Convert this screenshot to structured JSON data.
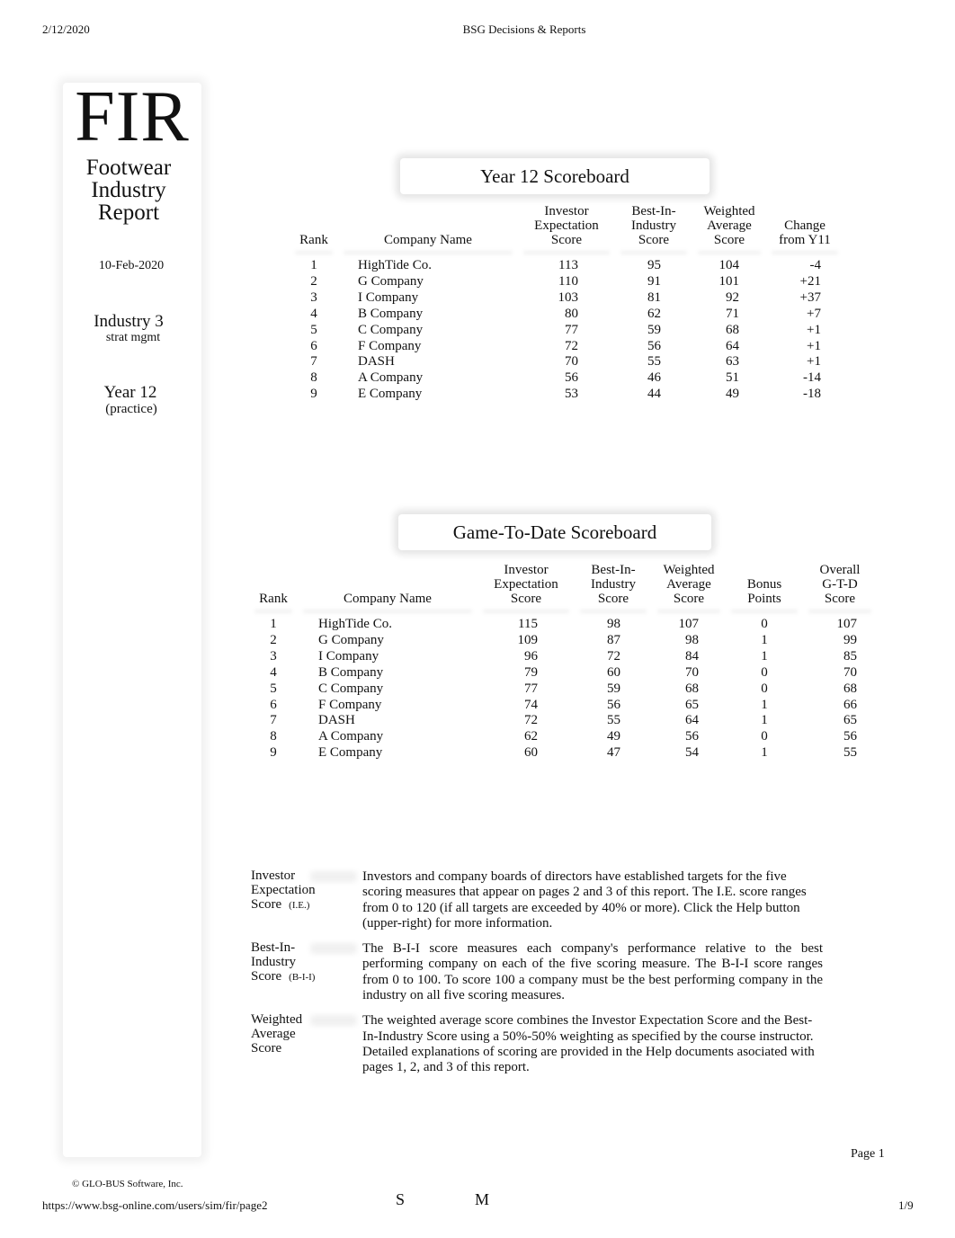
{
  "print_header": {
    "date": "2/12/2020",
    "title": "BSG Decisions & Reports"
  },
  "sidebar": {
    "abbreviation": "FIR",
    "title_lines": [
      "Footwear",
      "Industry",
      "Report"
    ],
    "report_date": "10-Feb-2020",
    "industry": "Industry 3",
    "course": "strat mgmt",
    "year": "Year 12",
    "mode": "(practice)"
  },
  "year_scoreboard": {
    "title": "Year 12 Scoreboard",
    "headers": {
      "rank": "Rank",
      "company": "Company Name",
      "ie": [
        "Investor",
        "Expectation",
        "Score"
      ],
      "bii": [
        "Best-In-",
        "Industry",
        "Score"
      ],
      "wa": [
        "Weighted",
        "Average",
        "Score"
      ],
      "change": [
        "Change",
        "from Y11"
      ]
    },
    "rows": [
      {
        "rank": "1",
        "company": "HighTide Co.",
        "ie": "113",
        "bii": "95",
        "wa": "104",
        "change": "-4"
      },
      {
        "rank": "2",
        "company": "G Company",
        "ie": "110",
        "bii": "91",
        "wa": "101",
        "change": "+21"
      },
      {
        "rank": "3",
        "company": "I Company",
        "ie": "103",
        "bii": "81",
        "wa": "92",
        "change": "+37"
      },
      {
        "rank": "4",
        "company": "B Company",
        "ie": "80",
        "bii": "62",
        "wa": "71",
        "change": "+7"
      },
      {
        "rank": "5",
        "company": "C Company",
        "ie": "77",
        "bii": "59",
        "wa": "68",
        "change": "+1"
      },
      {
        "rank": "6",
        "company": "F Company",
        "ie": "72",
        "bii": "56",
        "wa": "64",
        "change": "+1"
      },
      {
        "rank": "7",
        "company": "DASH",
        "ie": "70",
        "bii": "55",
        "wa": "63",
        "change": "+1"
      },
      {
        "rank": "8",
        "company": "A Company",
        "ie": "56",
        "bii": "46",
        "wa": "51",
        "change": "-14"
      },
      {
        "rank": "9",
        "company": "E Company",
        "ie": "53",
        "bii": "44",
        "wa": "49",
        "change": "-18"
      }
    ]
  },
  "gtd_scoreboard": {
    "title": "Game-To-Date Scoreboard",
    "headers": {
      "rank": "Rank",
      "company": "Company Name",
      "ie": [
        "Investor",
        "Expectation",
        "Score"
      ],
      "bii": [
        "Best-In-",
        "Industry",
        "Score"
      ],
      "wa": [
        "Weighted",
        "Average",
        "Score"
      ],
      "bonus": [
        "Bonus",
        "Points"
      ],
      "overall": [
        "Overall",
        "G-T-D",
        "Score"
      ]
    },
    "rows": [
      {
        "rank": "1",
        "company": "HighTide Co.",
        "ie": "115",
        "bii": "98",
        "wa": "107",
        "bonus": "0",
        "overall": "107"
      },
      {
        "rank": "2",
        "company": "G Company",
        "ie": "109",
        "bii": "87",
        "wa": "98",
        "bonus": "1",
        "overall": "99"
      },
      {
        "rank": "3",
        "company": "I Company",
        "ie": "96",
        "bii": "72",
        "wa": "84",
        "bonus": "1",
        "overall": "85"
      },
      {
        "rank": "4",
        "company": "B Company",
        "ie": "79",
        "bii": "60",
        "wa": "70",
        "bonus": "0",
        "overall": "70"
      },
      {
        "rank": "5",
        "company": "C Company",
        "ie": "77",
        "bii": "59",
        "wa": "68",
        "bonus": "0",
        "overall": "68"
      },
      {
        "rank": "6",
        "company": "F Company",
        "ie": "74",
        "bii": "56",
        "wa": "65",
        "bonus": "1",
        "overall": "66"
      },
      {
        "rank": "7",
        "company": "DASH",
        "ie": "72",
        "bii": "55",
        "wa": "64",
        "bonus": "1",
        "overall": "65"
      },
      {
        "rank": "8",
        "company": "A Company",
        "ie": "62",
        "bii": "49",
        "wa": "56",
        "bonus": "0",
        "overall": "56"
      },
      {
        "rank": "9",
        "company": "E Company",
        "ie": "60",
        "bii": "47",
        "wa": "54",
        "bonus": "1",
        "overall": "55"
      }
    ]
  },
  "definitions": [
    {
      "term_lines": [
        "Investor",
        "Expectation",
        "Score"
      ],
      "abbr": "(I.E.)",
      "text": "Investors and company boards of directors have established targets for the five scoring measures that appear on pages 2 and 3 of this report. The I.E. score ranges from 0 to 120 (if all targets are exceeded by 40% or more). Click the Help button (upper-right) for more information."
    },
    {
      "term_lines": [
        "Best-In-",
        "Industry",
        "Score"
      ],
      "abbr": "(B-I-I)",
      "text": "The B-I-I score measures each company's performance relative to the best performing company on each of the five scoring measure. The B-I-I score ranges from 0 to 100. To score 100 a company must be the best performing company in the industry on all five scoring measures."
    },
    {
      "term_lines": [
        "Weighted",
        "Average",
        "Score"
      ],
      "abbr": "",
      "text": "The weighted average score combines the Investor Expectation Score and the Best-In-Industry Score using a 50%-50% weighting as specified by the course instructor. Detailed explanations of scoring are provided in the Help documents asociated with pages 1, 2, and 3 of this report."
    }
  ],
  "footer": {
    "page_label": "Page 1",
    "copyright": "© GLO-BUS Software, Inc.",
    "url": "https://www.bsg-online.com/users/sim/fir/page2",
    "letter_s": "S",
    "letter_m": "M",
    "page_count": "1/9"
  }
}
